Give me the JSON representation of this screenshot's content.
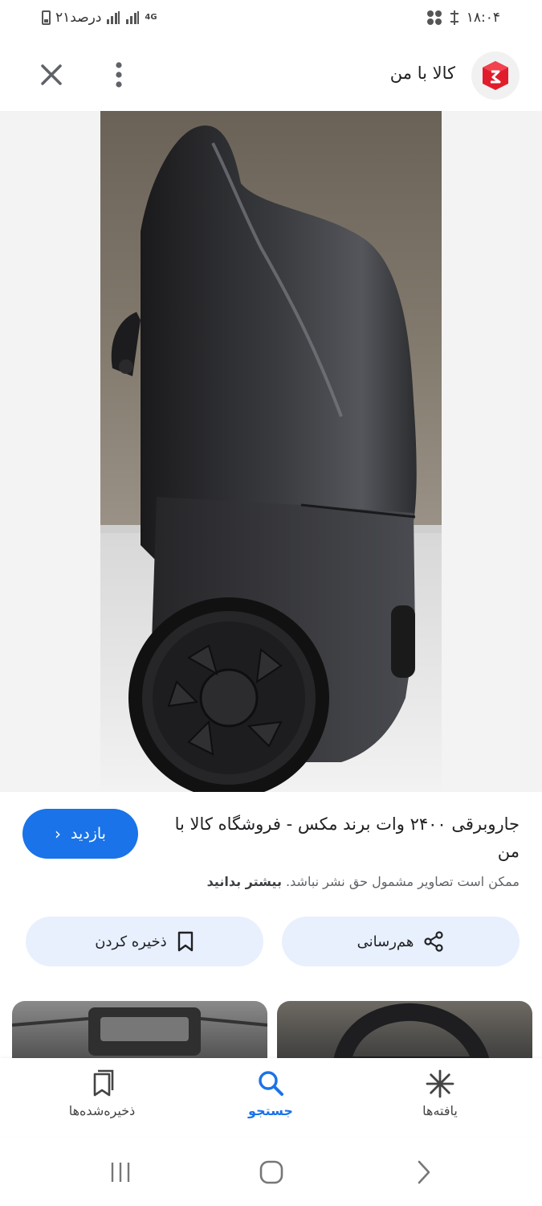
{
  "status_bar": {
    "battery_text": "۲۱درصد",
    "network_type": "4G",
    "time": "۱۸:۰۴"
  },
  "header": {
    "site_name": "کالا با من",
    "close_icon": "close-icon",
    "more_icon": "more-vert-icon"
  },
  "result": {
    "title": "جاروبرقی ۲۴۰۰ وات برند مکس - فروشگاه کالا با من",
    "visit_label": "بازدید",
    "notice_text": "ممکن است تصاویر مشمول حق نشر نباشد.",
    "learn_more": "بیشتر بدانید"
  },
  "actions": {
    "share_label": "هم‌رسانی",
    "save_label": "ذخیره کردن"
  },
  "bottom_nav": {
    "saved_label": "ذخیره‌شده‌ها",
    "search_label": "جستجو",
    "found_label": "یافته‌ها"
  },
  "colors": {
    "accent": "#1a73e8",
    "action_bg": "#e8f0fe",
    "logo_red": "#e11d2b"
  }
}
